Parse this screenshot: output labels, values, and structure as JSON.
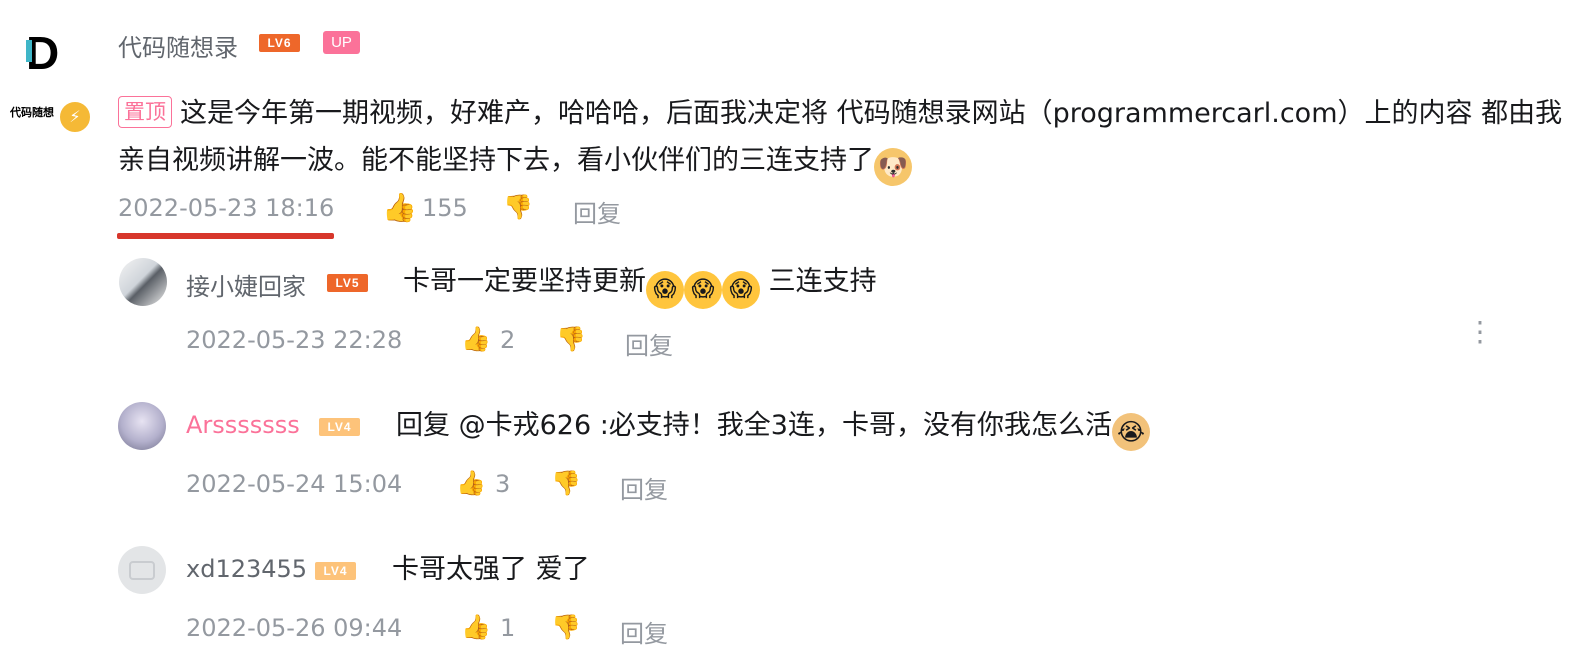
{
  "main_comment": {
    "avatar_text": "代码随想",
    "avatar_letter": "D",
    "username": "代码随想录",
    "level": "LV6",
    "up_tag": "UP",
    "pin_tag": "置顶",
    "text": "这是今年第一期视频，好难产，哈哈哈，后面我决定将 代码随想录网站（programmercarl.com）上的内容 都由我亲自视频讲解一波。能不能坚持下去，看小伙伴们的三连支持了",
    "time": "2022-05-23 18:16",
    "likes": "155",
    "reply_label": "回复",
    "icons": [
      "thumbs-up-icon",
      "thumbs-down-icon",
      "lightning-icon"
    ]
  },
  "replies": [
    {
      "username": "接小婕回家",
      "level": "LV5",
      "name_color": "#61666d",
      "text_before": "卡哥一定要坚持更新",
      "text_after": " 三连支持",
      "time": "2022-05-23 22:28",
      "likes": "2",
      "reply_label": "回复"
    },
    {
      "username": "Arsssssss",
      "level": "LV4",
      "name_color": "#fb7299",
      "text": "回复 @卡戎626 :必支持！我全3连，卡哥，没有你我怎么活",
      "time": "2022-05-24 15:04",
      "likes": "3",
      "reply_label": "回复"
    },
    {
      "username": "xd123455",
      "level": "LV4",
      "name_color": "#61666d",
      "text": "卡哥太强了 爱了",
      "time": "2022-05-26 09:44",
      "likes": "1",
      "reply_label": "回复"
    }
  ],
  "colors": {
    "accent_pink": "#fb7299",
    "like_blue": "#00aeec",
    "meta_gray": "#9499a0",
    "underline_red": "#d7362b"
  }
}
